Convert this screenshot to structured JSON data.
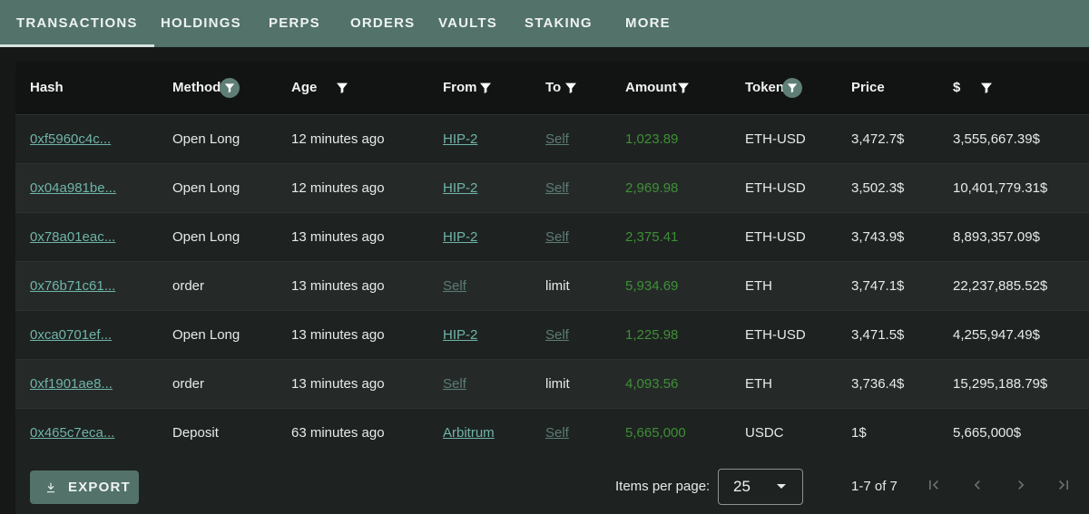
{
  "tabs": [
    {
      "label": "TRANSACTIONS",
      "active": true
    },
    {
      "label": "HOLDINGS"
    },
    {
      "label": "PERPS"
    },
    {
      "label": "ORDERS"
    },
    {
      "label": "VAULTS"
    },
    {
      "label": "STAKING"
    },
    {
      "label": "MORE"
    }
  ],
  "table": {
    "columns": [
      "Hash",
      "Method",
      "Age",
      "From",
      "To",
      "Amount",
      "Token",
      "Price",
      "$"
    ],
    "rows": [
      {
        "hash": "0xf5960c4c...",
        "method": "Open Long",
        "age": "12 minutes ago",
        "from": "HIP-2",
        "to": "Self",
        "amount": "1,023.89",
        "token": "ETH-USD",
        "price": "3,472.7$",
        "usd": "3,555,667.39$"
      },
      {
        "hash": "0x04a981be...",
        "method": "Open Long",
        "age": "12 minutes ago",
        "from": "HIP-2",
        "to": "Self",
        "amount": "2,969.98",
        "token": "ETH-USD",
        "price": "3,502.3$",
        "usd": "10,401,779.31$"
      },
      {
        "hash": "0x78a01eac...",
        "method": "Open Long",
        "age": "13 minutes ago",
        "from": "HIP-2",
        "to": "Self",
        "amount": "2,375.41",
        "token": "ETH-USD",
        "price": "3,743.9$",
        "usd": "8,893,357.09$"
      },
      {
        "hash": "0x76b71c61...",
        "method": "order",
        "age": "13 minutes ago",
        "from": "Self",
        "to": "limit",
        "amount": "5,934.69",
        "token": "ETH",
        "price": "3,747.1$",
        "usd": "22,237,885.52$"
      },
      {
        "hash": "0xca0701ef...",
        "method": "Open Long",
        "age": "13 minutes ago",
        "from": "HIP-2",
        "to": "Self",
        "amount": "1,225.98",
        "token": "ETH-USD",
        "price": "3,471.5$",
        "usd": "4,255,947.49$"
      },
      {
        "hash": "0xf1901ae8...",
        "method": "order",
        "age": "13 minutes ago",
        "from": "Self",
        "to": "limit",
        "amount": "4,093.56",
        "token": "ETH",
        "price": "3,736.4$",
        "usd": "15,295,188.79$"
      },
      {
        "hash": "0x465c7eca...",
        "method": "Deposit",
        "age": "63 minutes ago",
        "from": "Arbitrum",
        "to": "Self",
        "amount": "5,665,000",
        "token": "USDC",
        "price": "1$",
        "usd": "5,665,000$"
      }
    ]
  },
  "footer": {
    "export_label": "EXPORT",
    "items_per_page_label": "Items per page:",
    "items_per_page_value": "25",
    "range_text": "1-7 of 7"
  },
  "icons": {
    "filter": "filter-icon",
    "download": "download-icon",
    "first_page": "first-page-icon",
    "prev_page": "chevron-left-icon",
    "next_page": "chevron-right-icon",
    "last_page": "last-page-icon"
  },
  "colors": {
    "tab_bar": "#52726a",
    "link": "#6fb4a7",
    "link_dim": "#5c7c75",
    "amount": "#3f8f36",
    "active_filter": "#5e7e76"
  }
}
